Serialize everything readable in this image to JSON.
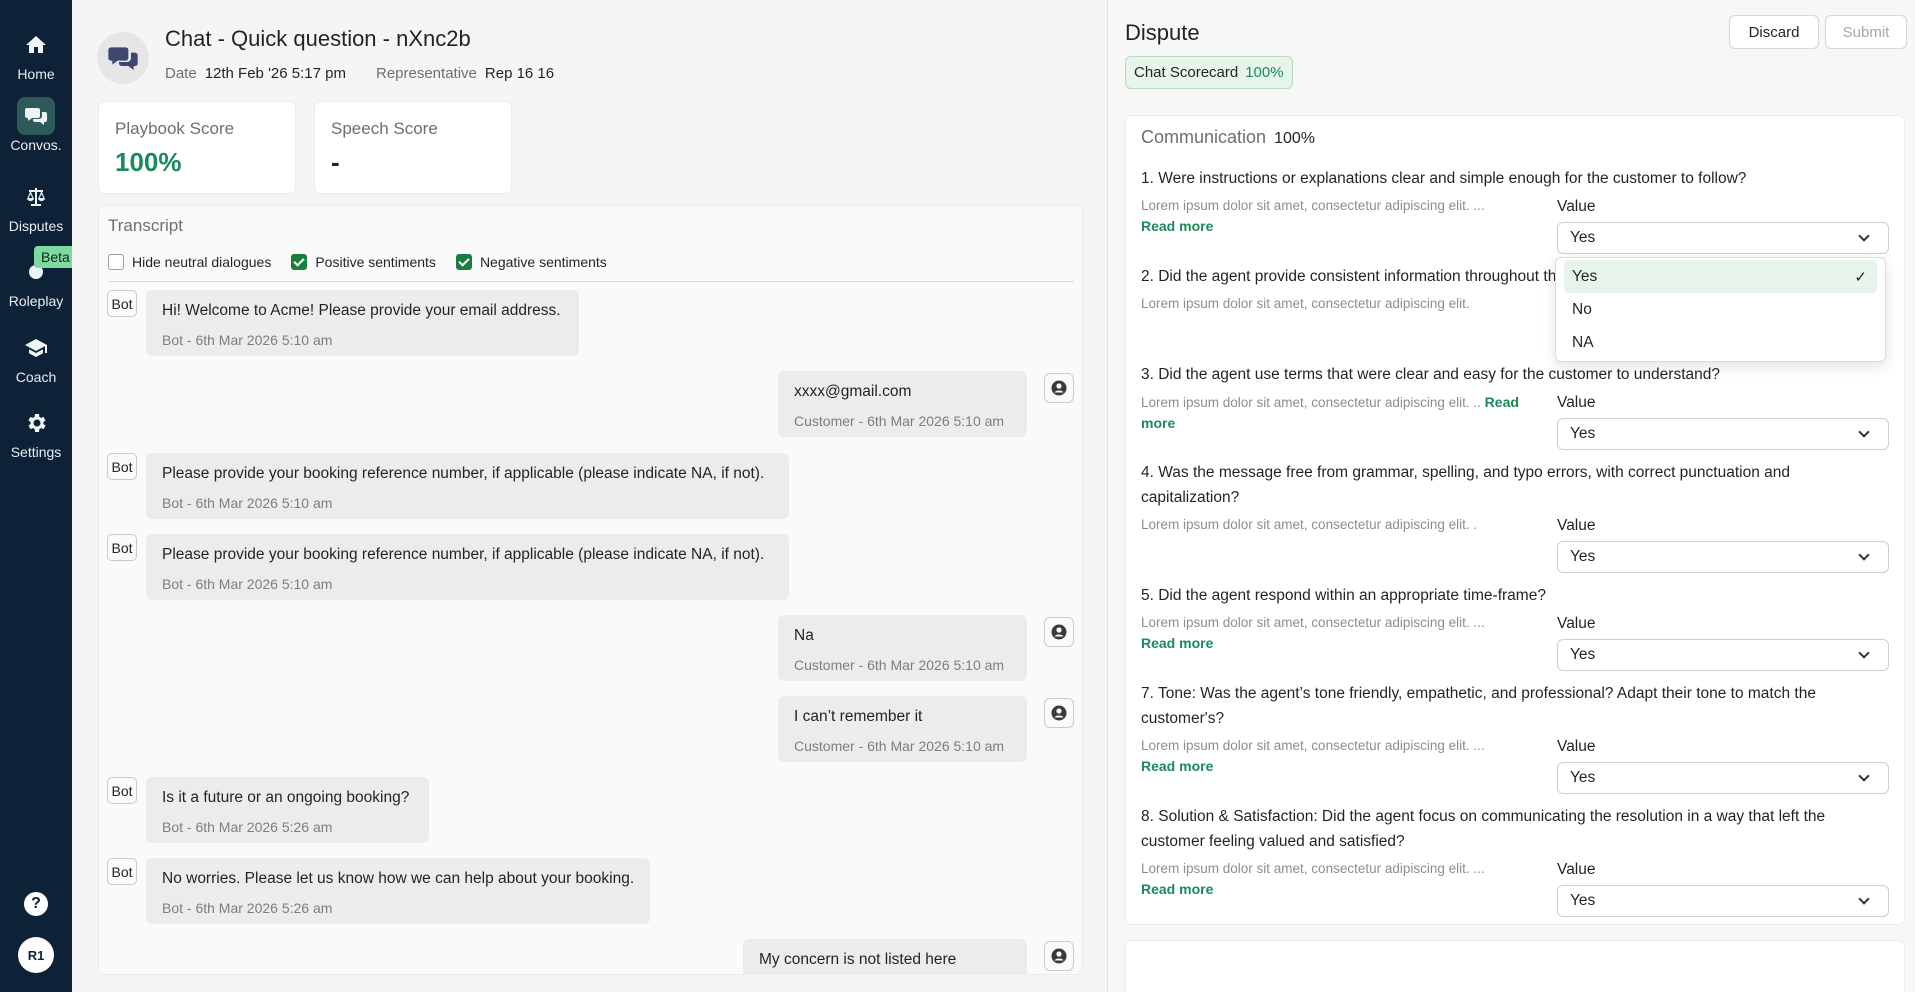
{
  "sidebar": {
    "items": [
      {
        "label": "Home",
        "icon": "home-icon"
      },
      {
        "label": "Convos.",
        "icon": "chat-icon",
        "active": true
      },
      {
        "label": "Disputes",
        "icon": "scale-icon"
      },
      {
        "label": "Roleplay",
        "icon": "roleplay-icon"
      },
      {
        "label": "Coach",
        "icon": "coach-icon"
      },
      {
        "label": "Settings",
        "icon": "gear-icon"
      }
    ],
    "beta_badge": "Beta",
    "help": "?",
    "avatar_initials": "R1"
  },
  "header": {
    "title": "Chat - Quick question - nXnc2b",
    "date_label": "Date",
    "date_value": "12th Feb '26 5:17 pm",
    "rep_label": "Representative",
    "rep_value": "Rep 16 16"
  },
  "scores": {
    "playbook_label": "Playbook Score",
    "playbook_value": "100%",
    "speech_label": "Speech Score",
    "speech_value": "-"
  },
  "transcript": {
    "title": "Transcript",
    "filters": {
      "hide_neutral": {
        "label": "Hide neutral dialogues",
        "checked": false
      },
      "positive": {
        "label": "Positive sentiments",
        "checked": true
      },
      "negative": {
        "label": "Negative sentiments",
        "checked": true
      }
    },
    "bot_tag": "Bot",
    "messages": [
      {
        "from": "bot",
        "text": "Hi! Welcome to Acme! Please provide your email address.",
        "meta": "Bot - 6th Mar 2026 5:10 am"
      },
      {
        "from": "customer",
        "text": "xxxx@gmail.com",
        "meta": "Customer - 6th Mar 2026 5:10 am"
      },
      {
        "from": "bot",
        "text": "Please provide your booking reference number, if applicable (please indicate NA, if not).",
        "meta": "Bot - 6th Mar 2026 5:10 am"
      },
      {
        "from": "bot",
        "text": "Please provide your booking reference number, if applicable (please indicate NA, if not).",
        "meta": "Bot - 6th Mar 2026 5:10 am"
      },
      {
        "from": "customer",
        "text": "Na",
        "meta": "Customer - 6th Mar 2026 5:10 am"
      },
      {
        "from": "customer",
        "text": "I can’t remember it",
        "meta": "Customer - 6th Mar 2026 5:10 am"
      },
      {
        "from": "bot",
        "text": "Is it a future or an ongoing booking?",
        "meta": "Bot - 6th Mar 2026 5:26 am"
      },
      {
        "from": "bot",
        "text": "No worries. Please let us know how we can help about your booking.",
        "meta": "Bot - 6th Mar 2026 5:26 am"
      },
      {
        "from": "customer",
        "text": "My concern is not listed here",
        "meta": ""
      }
    ]
  },
  "dispute": {
    "title": "Dispute",
    "discard_label": "Discard",
    "submit_label": "Submit",
    "scorecard_label": "Chat Scorecard",
    "scorecard_pct": "100%",
    "section_title": "Communication",
    "section_pct": "100%",
    "value_label": "Value",
    "read_more": "Read more",
    "questions": [
      {
        "q": "1. Were instructions or explanations clear and simple enough for the customer to follow?",
        "desc": "Lorem ipsum dolor sit amet, consectetur adipiscing elit. ...",
        "value": "Yes"
      },
      {
        "q": "2. Did the agent provide consistent information throughout the",
        "desc": "Lorem ipsum dolor sit amet, consectetur adipiscing elit.",
        "value": "Yes"
      },
      {
        "q": "3. Did the agent use terms that were clear and easy for the customer to understand?",
        "desc": "Lorem ipsum dolor sit amet, consectetur adipiscing elit. ..",
        "value": "Yes"
      },
      {
        "q": "4. Was the message free from grammar, spelling, and typo errors, with correct punctuation and capitalization?",
        "desc": "Lorem ipsum dolor sit amet, consectetur adipiscing elit. .",
        "value": "Yes"
      },
      {
        "q": "5. Did the agent respond within an appropriate time-frame?",
        "desc": "Lorem ipsum dolor sit amet, consectetur adipiscing elit. ...",
        "value": "Yes"
      },
      {
        "q": "7. Tone: Was the agent’s tone friendly, empathetic, and professional? Adapt their tone to match the customer's?",
        "desc": "Lorem ipsum dolor sit amet, consectetur adipiscing elit. ...",
        "value": "Yes"
      },
      {
        "q": "8. Solution & Satisfaction: Did the agent focus on communicating the resolution in a way that left the customer feeling valued and satisfied?",
        "desc": "Lorem ipsum dolor sit amet, consectetur adipiscing elit. ...",
        "value": "Yes"
      }
    ],
    "dropdown_options": [
      {
        "label": "Yes",
        "selected": true
      },
      {
        "label": "No",
        "selected": false
      },
      {
        "label": "NA",
        "selected": false
      }
    ],
    "check_mark": "✓"
  }
}
